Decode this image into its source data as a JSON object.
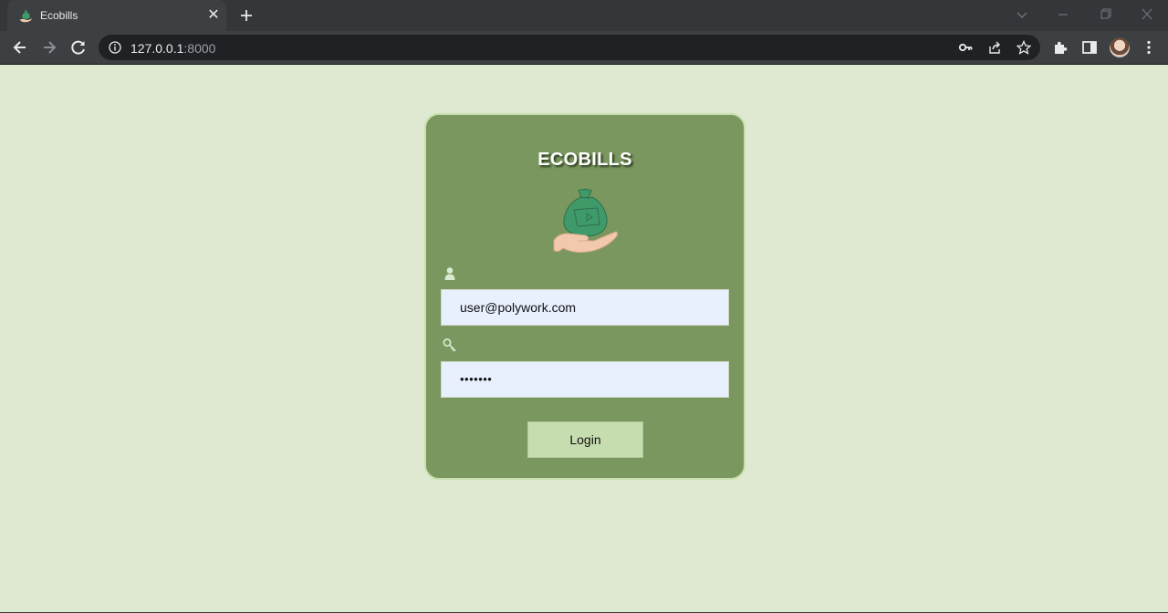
{
  "browser": {
    "tab_title": "Ecobills",
    "url_host": "127.0.0.1",
    "url_port": ":8000"
  },
  "login": {
    "brand": "ECOBILLS",
    "email_value": "user@polywork.com",
    "password_value": "•••••••",
    "login_label": "Login"
  },
  "icons": {
    "tab_favicon": "money-bag-hand-icon",
    "email": "user-icon",
    "password": "key-icon",
    "logo": "money-bag-hand-icon"
  },
  "colors": {
    "page_bg": "#dfe9d1",
    "card_bg": "#79975e",
    "card_border": "#c9dfae",
    "input_bg": "#e8f0fe",
    "button_bg": "#c6ddb0"
  }
}
